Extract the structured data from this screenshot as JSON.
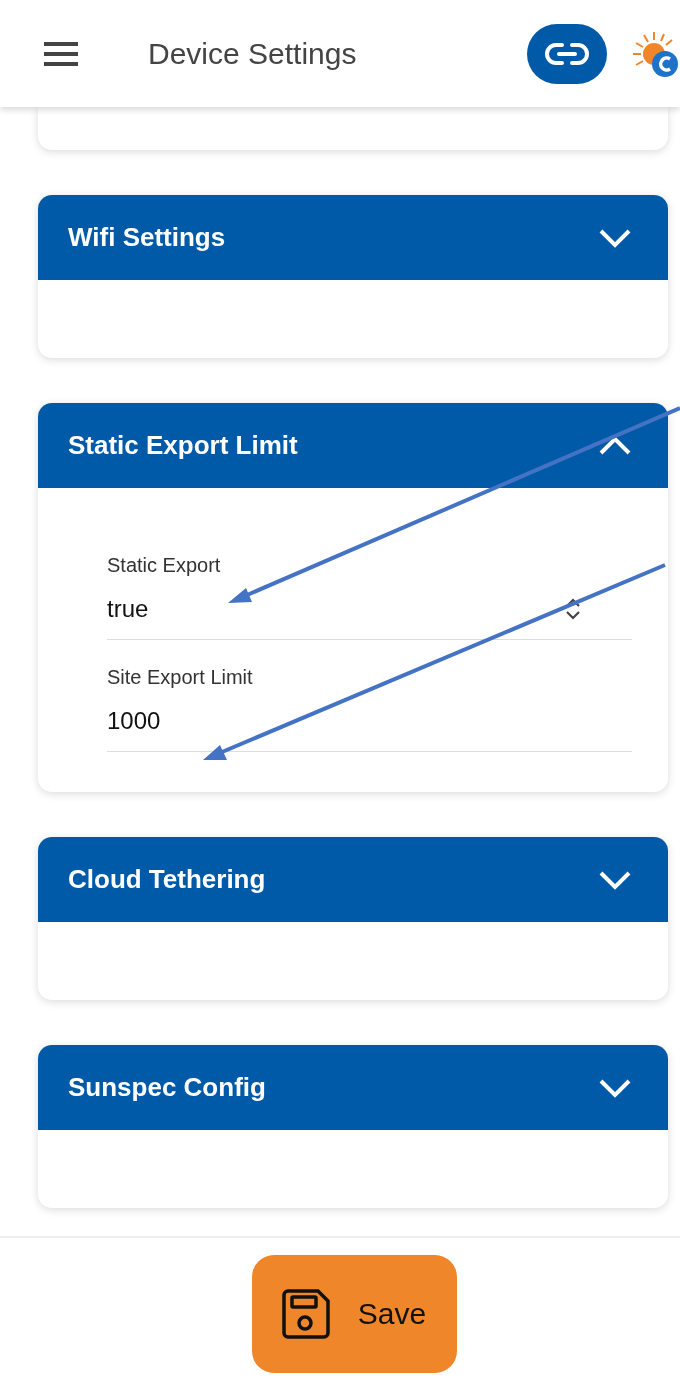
{
  "header": {
    "title": "Device Settings"
  },
  "sections": [
    {
      "title": "Wifi Settings",
      "expanded": false
    },
    {
      "title": "Static Export Limit",
      "expanded": true,
      "fields": [
        {
          "kind": "select",
          "label": "Static Export",
          "value": "true"
        },
        {
          "kind": "input",
          "label": "Site Export Limit",
          "value": "1000"
        }
      ]
    },
    {
      "title": "Cloud Tethering",
      "expanded": false
    },
    {
      "title": "Sunspec Config",
      "expanded": false
    }
  ],
  "save_button": {
    "label": "Save"
  }
}
